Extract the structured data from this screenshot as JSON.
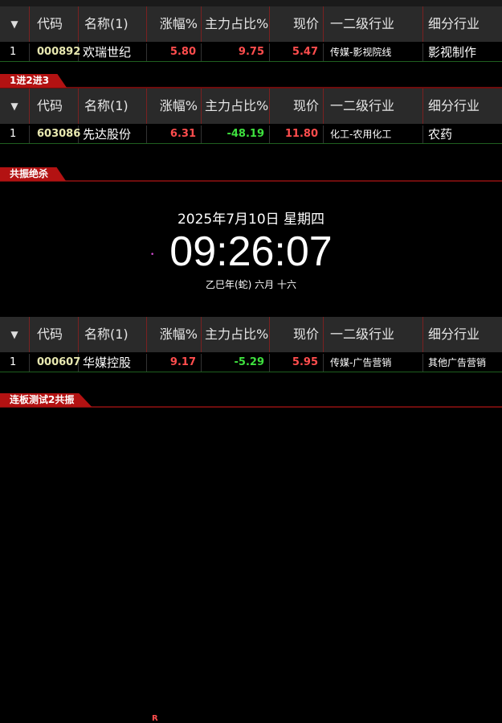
{
  "columns": {
    "code": "代码",
    "name": "名称(1)",
    "change": "涨幅%",
    "main_ratio": "主力占比%",
    "price": "现价",
    "industry": "一二级行业",
    "sub_industry": "细分行业"
  },
  "tables": [
    {
      "group": "",
      "rows": [
        {
          "index": "1",
          "code": "000892",
          "name": "欢瑞世纪",
          "flag": "",
          "change": "5.80",
          "main_ratio": "9.75",
          "price": "5.47",
          "industry": "传媒-影视院线",
          "sub_industry": "影视制作"
        }
      ]
    },
    {
      "group": "1进2进3",
      "rows": [
        {
          "index": "1",
          "code": "603086",
          "name": "先达股份",
          "flag": "•",
          "change": "6.31",
          "main_ratio": "-48.19",
          "price": "11.80",
          "industry": "化工-农用化工",
          "sub_industry": "农药"
        }
      ]
    },
    {
      "group": "共振绝杀",
      "rows": []
    },
    {
      "group": "",
      "rows": [
        {
          "index": "1",
          "code": "000607",
          "name": "华媒控股",
          "flag": "R",
          "change": "9.17",
          "main_ratio": "-5.29",
          "price": "5.95",
          "industry": "传媒-广告营销",
          "sub_industry": "其他广告营销"
        }
      ]
    },
    {
      "group": "连板测试2共振",
      "rows": []
    }
  ],
  "clock": {
    "date": "2025年7月10日 星期四",
    "time": "09:26:07",
    "lunar": "乙巳年(蛇) 六月 十六"
  },
  "colors": {
    "up": "#ff4d4d",
    "down": "#3ee03e",
    "group_tab": "#b31212"
  }
}
